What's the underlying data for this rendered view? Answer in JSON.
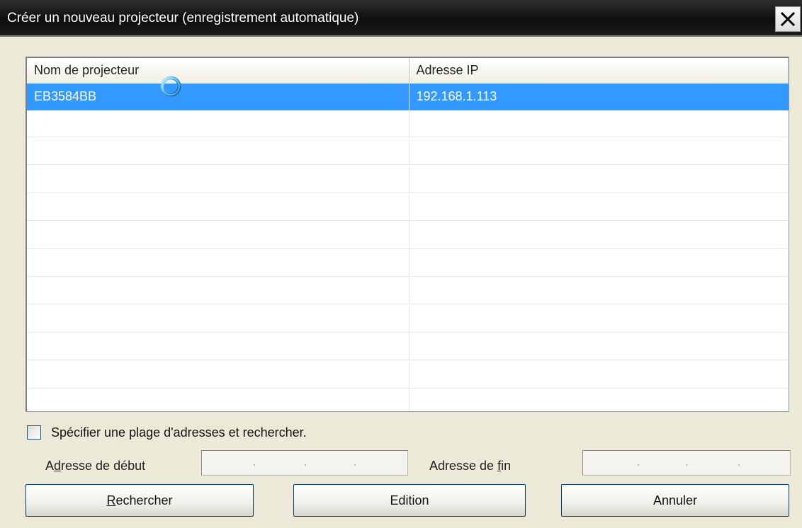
{
  "window": {
    "title": "Créer un nouveau projecteur (enregistrement automatique)",
    "close_icon": "close-icon"
  },
  "list": {
    "columns": [
      "Nom de projecteur",
      "Adresse IP"
    ],
    "rows": [
      {
        "name": "EB3584BB",
        "ip": "192.168.1.113",
        "selected": true
      }
    ],
    "empty_rows": 11,
    "selection_color": "#3399ff"
  },
  "range": {
    "checkbox_label": "Spécifier une plage d'adresses et rechercher.",
    "checked": false,
    "start_label_pre": "A",
    "start_label_ul": "d",
    "start_label_post": "resse de début",
    "end_label_pre": "Adresse de ",
    "end_label_ul": "f",
    "end_label_post": "in"
  },
  "buttons": {
    "search_ul": "R",
    "search_rest": "echercher",
    "edit_label": "Edition",
    "cancel_label": "Annuler"
  }
}
